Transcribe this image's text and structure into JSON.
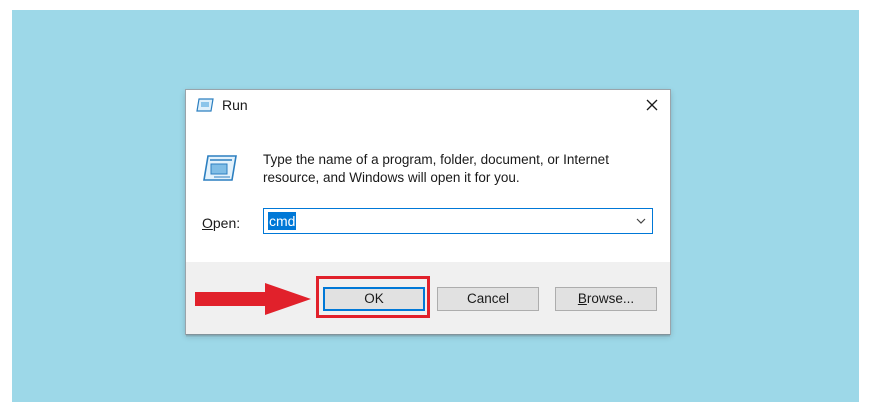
{
  "window": {
    "title": "Run"
  },
  "prompt": {
    "line1": "Type the name of a program, folder, document, or Internet",
    "line2": "resource, and Windows will open it for you."
  },
  "open": {
    "label_accel": "O",
    "label_rest": "pen:",
    "value": "cmd"
  },
  "buttons": {
    "ok": "OK",
    "cancel": "Cancel",
    "browse_accel": "B",
    "browse_rest": "rowse..."
  },
  "icons": {
    "title": "run-icon",
    "close": "close-icon",
    "dropdown": "chevron-down-icon"
  },
  "colors": {
    "backdrop": "#9dd8e8",
    "accent": "#0078d7",
    "highlight": "#e1212b"
  }
}
